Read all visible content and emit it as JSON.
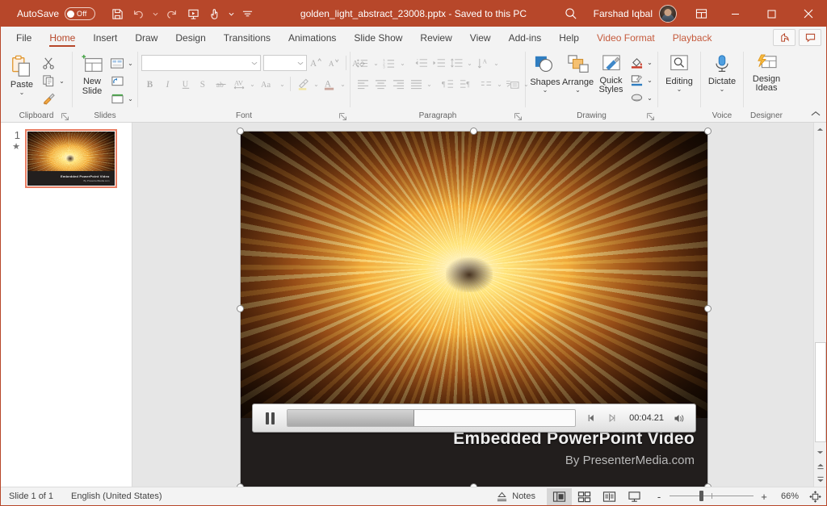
{
  "titlebar": {
    "autosave_label": "AutoSave",
    "autosave_state": "Off",
    "document_title": "golden_light_abstract_23008.pptx  -  Saved to this PC",
    "user_name": "Farshad Iqbal",
    "qat": [
      {
        "name": "save-icon",
        "label": "Save"
      },
      {
        "name": "undo-icon",
        "label": "Undo"
      },
      {
        "name": "redo-icon",
        "label": "Redo"
      },
      {
        "name": "start-presentation-icon",
        "label": "Start From Beginning"
      },
      {
        "name": "touch-mode-icon",
        "label": "Touch/Mouse Mode"
      },
      {
        "name": "customize-qat-icon",
        "label": "Customize Quick Access Toolbar"
      }
    ],
    "window_buttons": [
      "minimize",
      "maximize",
      "close"
    ],
    "accent_color": "#b7472a"
  },
  "tabs": [
    {
      "label": "File",
      "active": false,
      "contextual": false
    },
    {
      "label": "Home",
      "active": true,
      "contextual": false
    },
    {
      "label": "Insert",
      "active": false,
      "contextual": false
    },
    {
      "label": "Draw",
      "active": false,
      "contextual": false
    },
    {
      "label": "Design",
      "active": false,
      "contextual": false
    },
    {
      "label": "Transitions",
      "active": false,
      "contextual": false
    },
    {
      "label": "Animations",
      "active": false,
      "contextual": false
    },
    {
      "label": "Slide Show",
      "active": false,
      "contextual": false
    },
    {
      "label": "Review",
      "active": false,
      "contextual": false
    },
    {
      "label": "View",
      "active": false,
      "contextual": false
    },
    {
      "label": "Add-ins",
      "active": false,
      "contextual": false
    },
    {
      "label": "Help",
      "active": false,
      "contextual": false
    },
    {
      "label": "Video Format",
      "active": false,
      "contextual": true
    },
    {
      "label": "Playback",
      "active": false,
      "contextual": true
    }
  ],
  "tab_right_buttons": [
    {
      "name": "share-button",
      "label": "Share"
    },
    {
      "name": "comments-button",
      "label": "Comments"
    }
  ],
  "ribbon": {
    "groups": [
      {
        "name": "clipboard",
        "label": "Clipboard",
        "has_dialog_launcher": true,
        "buttons": [
          {
            "label": "Paste",
            "name": "paste-button",
            "dropdown": true
          },
          {
            "label": "Cut",
            "name": "cut-button"
          },
          {
            "label": "Copy",
            "name": "copy-button",
            "dropdown": true
          },
          {
            "label": "Format Painter",
            "name": "format-painter-button"
          }
        ]
      },
      {
        "name": "slides",
        "label": "Slides",
        "has_dialog_launcher": false,
        "buttons": [
          {
            "label": "New Slide",
            "name": "new-slide-button",
            "dropdown": true
          },
          {
            "label": "Layout",
            "name": "layout-button",
            "dropdown": true
          },
          {
            "label": "Reset",
            "name": "reset-button"
          },
          {
            "label": "Section",
            "name": "section-button",
            "dropdown": true
          }
        ]
      },
      {
        "name": "font",
        "label": "Font",
        "has_dialog_launcher": true,
        "disabled": true,
        "font_name_value": "",
        "font_size_value": "",
        "buttons": [
          {
            "label": "Increase Font Size",
            "name": "increase-font-size-button"
          },
          {
            "label": "Decrease Font Size",
            "name": "decrease-font-size-button"
          },
          {
            "label": "Clear All Formatting",
            "name": "clear-formatting-button"
          },
          {
            "label": "Bold",
            "name": "bold-button"
          },
          {
            "label": "Italic",
            "name": "italic-button"
          },
          {
            "label": "Underline",
            "name": "underline-button"
          },
          {
            "label": "Text Shadow",
            "name": "text-shadow-button"
          },
          {
            "label": "Strikethrough",
            "name": "strikethrough-button"
          },
          {
            "label": "Character Spacing",
            "name": "character-spacing-button"
          },
          {
            "label": "Change Case",
            "name": "change-case-button"
          },
          {
            "label": "Text Highlight Color",
            "name": "text-highlight-color-button"
          },
          {
            "label": "Font Color",
            "name": "font-color-button"
          }
        ]
      },
      {
        "name": "paragraph",
        "label": "Paragraph",
        "has_dialog_launcher": true,
        "disabled": true,
        "buttons": [
          {
            "label": "Bullets",
            "name": "bullets-button"
          },
          {
            "label": "Numbering",
            "name": "numbering-button"
          },
          {
            "label": "Decrease List Level",
            "name": "decrease-indent-button"
          },
          {
            "label": "Increase List Level",
            "name": "increase-indent-button"
          },
          {
            "label": "Line Spacing",
            "name": "line-spacing-button"
          },
          {
            "label": "Align Left",
            "name": "align-left-button"
          },
          {
            "label": "Center",
            "name": "align-center-button"
          },
          {
            "label": "Align Right",
            "name": "align-right-button"
          },
          {
            "label": "Justify",
            "name": "justify-button"
          },
          {
            "label": "Columns",
            "name": "columns-button"
          },
          {
            "label": "Text Direction",
            "name": "text-direction-button"
          },
          {
            "label": "Align Text",
            "name": "align-text-button"
          },
          {
            "label": "Convert to SmartArt",
            "name": "convert-to-smartart-button"
          }
        ]
      },
      {
        "name": "drawing",
        "label": "Drawing",
        "has_dialog_launcher": true,
        "buttons": [
          {
            "label": "Shapes",
            "name": "shapes-button",
            "dropdown": true
          },
          {
            "label": "Arrange",
            "name": "arrange-button",
            "dropdown": true
          },
          {
            "label": "Quick Styles",
            "name": "quick-styles-button",
            "dropdown": true
          },
          {
            "label": "Shape Fill",
            "name": "shape-fill-button"
          },
          {
            "label": "Shape Outline",
            "name": "shape-outline-button"
          },
          {
            "label": "Shape Effects",
            "name": "shape-effects-button"
          }
        ]
      },
      {
        "name": "editing",
        "label": "",
        "has_dialog_launcher": false,
        "buttons": [
          {
            "label": "Editing",
            "name": "editing-button",
            "dropdown": true
          }
        ]
      },
      {
        "name": "voice",
        "label": "Voice",
        "has_dialog_launcher": false,
        "buttons": [
          {
            "label": "Dictate",
            "name": "dictate-button",
            "dropdown": true
          }
        ]
      },
      {
        "name": "designer",
        "label": "Designer",
        "has_dialog_launcher": false,
        "buttons": [
          {
            "label": "Design\nIdeas",
            "name": "design-ideas-button"
          }
        ]
      }
    ],
    "collapse_ribbon_label": "Collapse the Ribbon"
  },
  "thumbnails": [
    {
      "number": "1",
      "has_animation_star": true,
      "selected": true
    }
  ],
  "slide": {
    "video_title": "Embedded PowerPoint Video",
    "video_subtitle": "By PresenterMedia.com",
    "selected": true,
    "playback": {
      "state_icon": "pause-icon",
      "progress_percent": 44,
      "timecode": "00:04.21",
      "prev_frame_label": "Previous Frame",
      "next_frame_label": "Next Frame",
      "volume_icon": "volume-icon"
    }
  },
  "statusbar": {
    "slide_indicator": "Slide 1 of 1",
    "language": "English (United States)",
    "notes_label": "Notes",
    "views": [
      {
        "name": "normal-view-button",
        "label": "Normal",
        "active": true
      },
      {
        "name": "slide-sorter-view-button",
        "label": "Slide Sorter",
        "active": false
      },
      {
        "name": "reading-view-button",
        "label": "Reading View",
        "active": false
      },
      {
        "name": "slide-show-button",
        "label": "Slide Show",
        "active": false
      }
    ],
    "zoom_out_label": "-",
    "zoom_in_label": "+",
    "zoom_percent": "66%",
    "fit_label": "Fit slide to current window"
  }
}
